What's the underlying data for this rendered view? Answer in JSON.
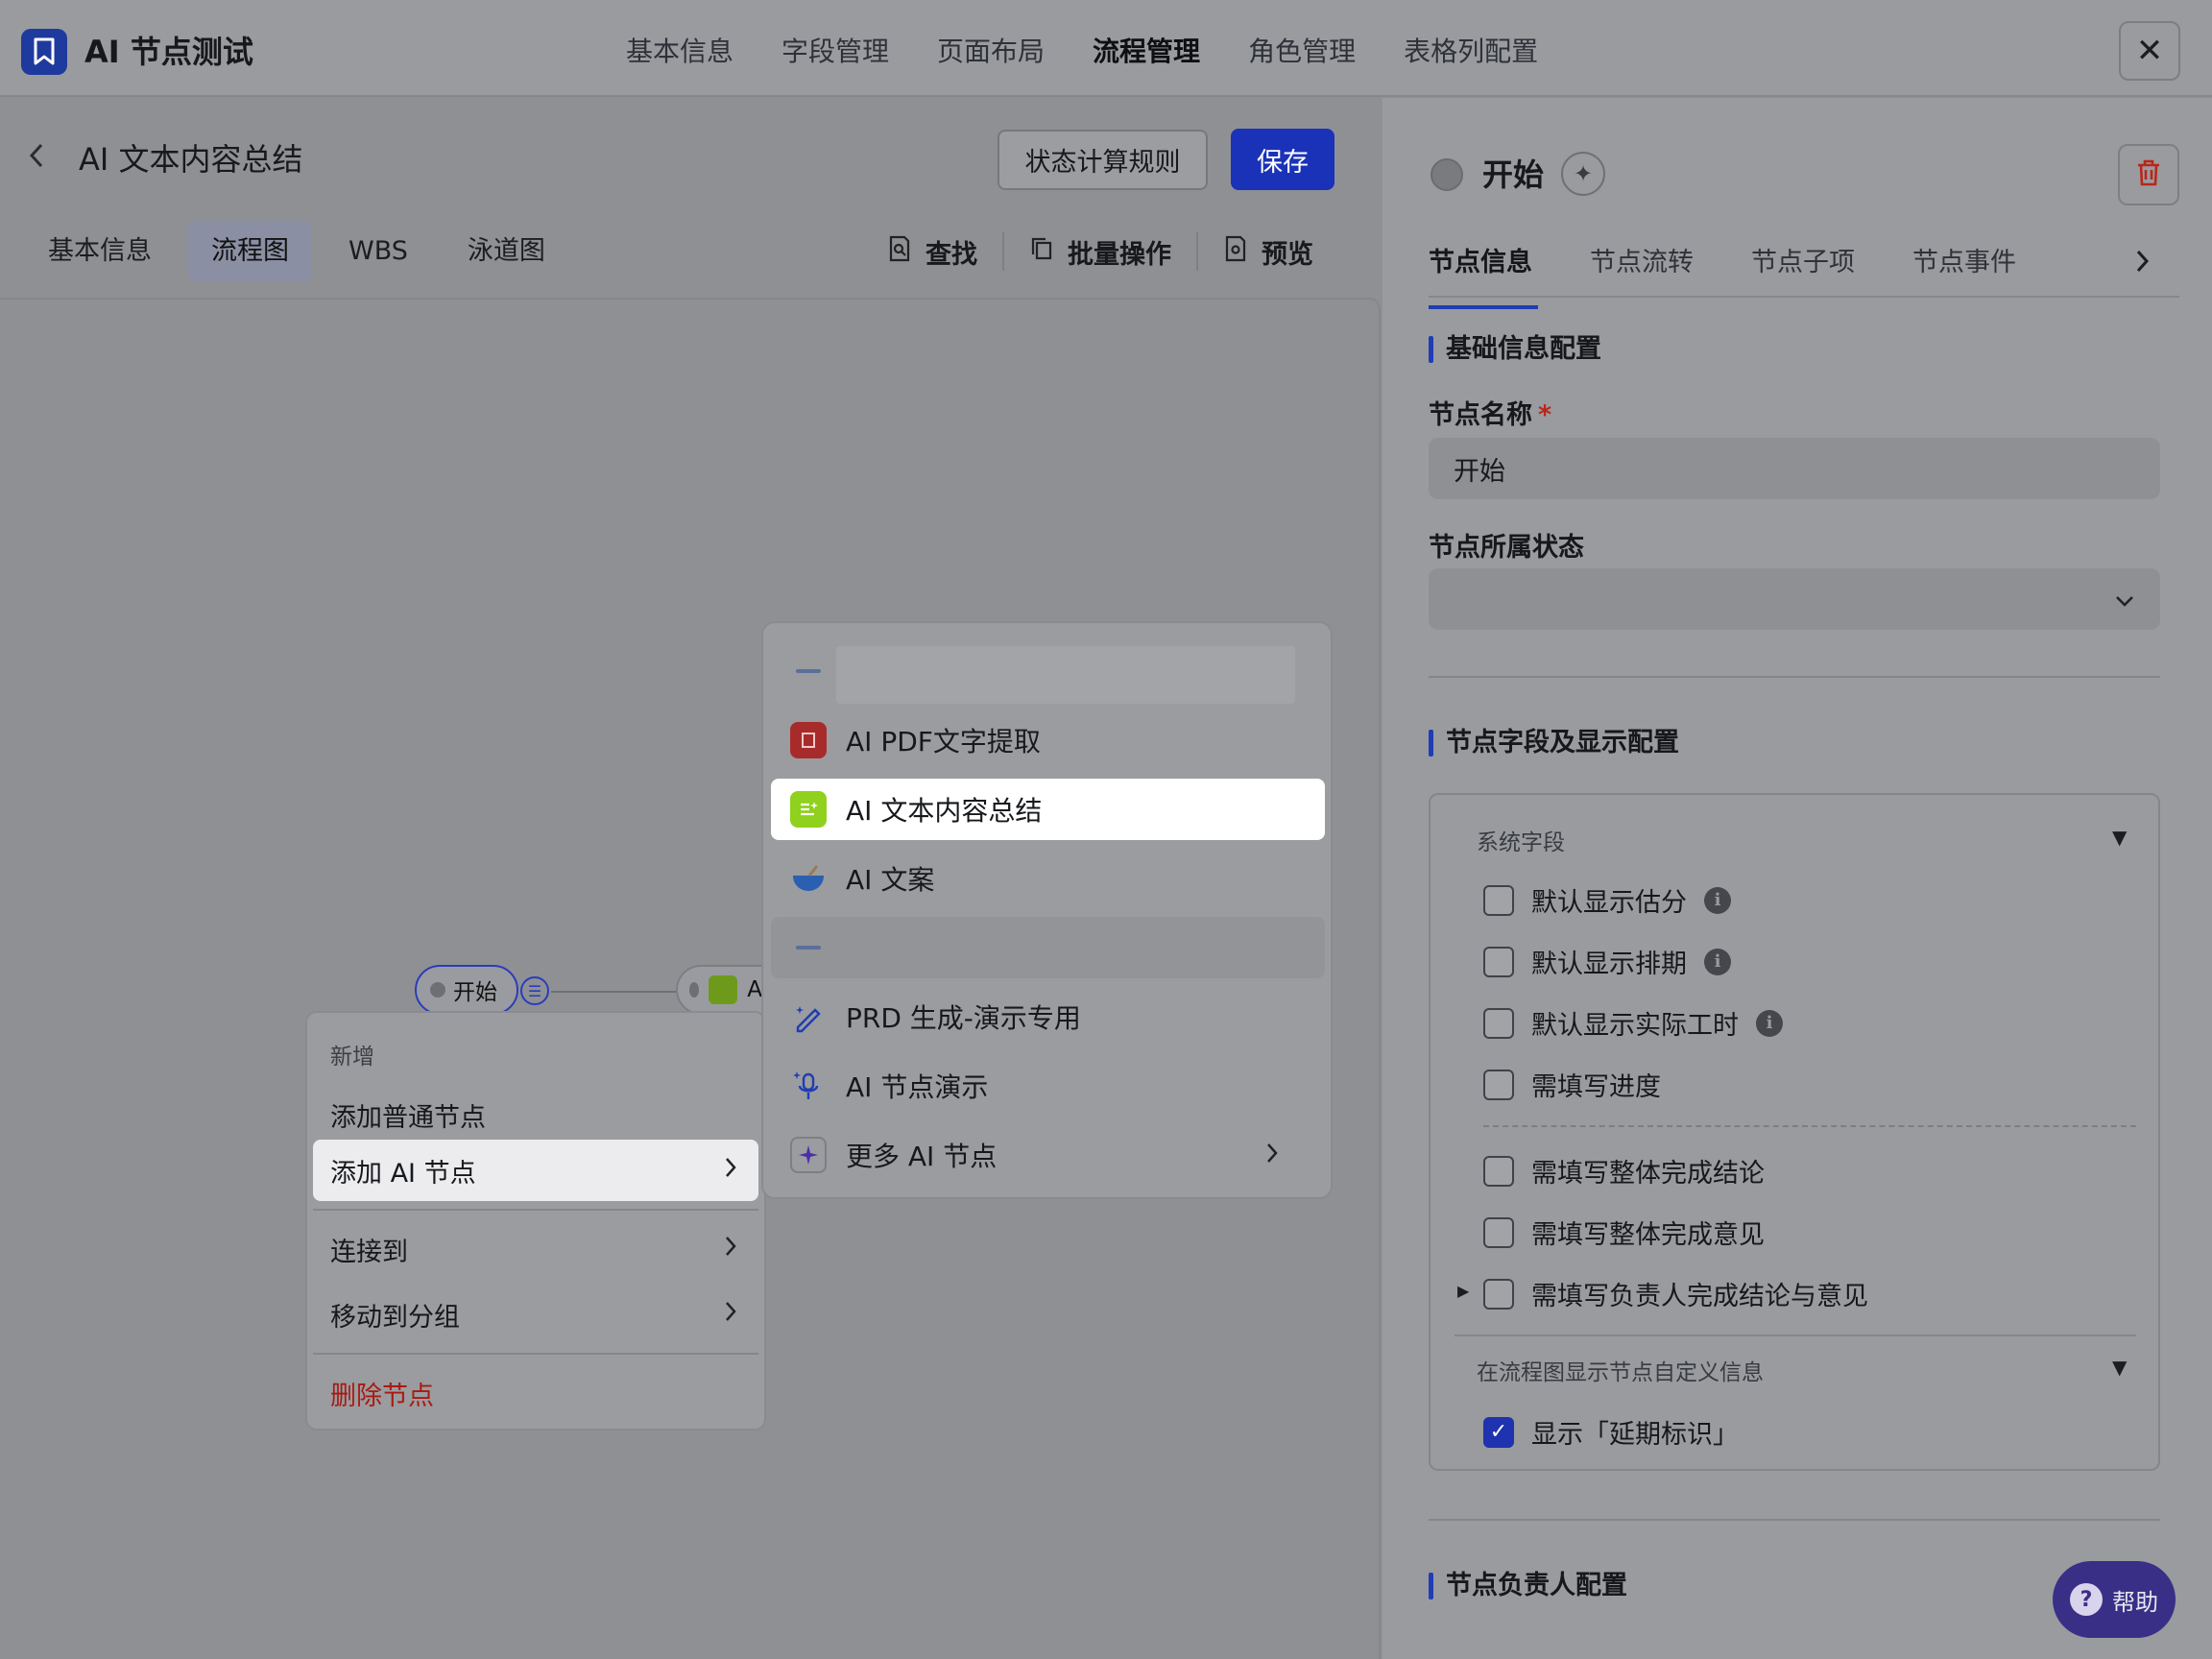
{
  "app": {
    "title": "AI 节点测试",
    "close_label": "✕"
  },
  "top_nav": [
    {
      "label": "基本信息",
      "active": false
    },
    {
      "label": "字段管理",
      "active": false
    },
    {
      "label": "页面布局",
      "active": false
    },
    {
      "label": "流程管理",
      "active": true
    },
    {
      "label": "角色管理",
      "active": false
    },
    {
      "label": "表格列配置",
      "active": false
    }
  ],
  "header": {
    "title": "AI 文本内容总结",
    "rule_button": "状态计算规则",
    "save_button": "保存"
  },
  "sub_tabs": [
    {
      "label": "基本信息",
      "active": false
    },
    {
      "label": "流程图",
      "active": true
    },
    {
      "label": "WBS",
      "active": false
    },
    {
      "label": "泳道图",
      "active": false
    }
  ],
  "tools": {
    "find": "查找",
    "batch": "批量操作",
    "preview": "预览"
  },
  "flow": {
    "start_node": "开始",
    "ai_node_partial": "A"
  },
  "context_menu": {
    "section": "新增",
    "add_normal": "添加普通节点",
    "add_ai": "添加 AI 节点",
    "connect": "连接到",
    "move_group": "移动到分组",
    "delete": "删除节点"
  },
  "ai_submenu": {
    "items": [
      {
        "label": "AI PDF文字提取",
        "icon": "pdf-icon"
      },
      {
        "label": "AI 文本内容总结",
        "icon": "summary-icon",
        "highlighted": true
      },
      {
        "label": "AI 文案",
        "icon": "bowl-icon"
      },
      {
        "label": "PRD 生成-演示专用",
        "icon": "magic-pen-icon"
      },
      {
        "label": "AI 节点演示",
        "icon": "mic-sparkle-icon"
      },
      {
        "label": "更多 AI 节点",
        "icon": "sparkle-icon"
      }
    ]
  },
  "panel": {
    "node_title": "开始",
    "tabs": [
      {
        "label": "节点信息",
        "active": true
      },
      {
        "label": "节点流转",
        "active": false
      },
      {
        "label": "节点子项",
        "active": false
      },
      {
        "label": "节点事件",
        "active": false
      }
    ],
    "section_basic": "基础信息配置",
    "name_label": "节点名称",
    "required_mark": "*",
    "name_value": "开始",
    "status_label": "节点所属状态",
    "status_value": "",
    "section_fields": "节点字段及显示配置",
    "system_fields_title": "系统字段",
    "checkboxes": [
      {
        "label": "默认显示估分",
        "checked": false,
        "info": true
      },
      {
        "label": "默认显示排期",
        "checked": false,
        "info": true
      },
      {
        "label": "默认显示实际工时",
        "checked": false,
        "info": true
      },
      {
        "label": "需填写进度",
        "checked": false,
        "info": false
      },
      {
        "label": "需填写整体完成结论",
        "checked": false,
        "info": false
      },
      {
        "label": "需填写整体完成意见",
        "checked": false,
        "info": false
      },
      {
        "label": "需填写负责人完成结论与意见",
        "checked": false,
        "info": false
      }
    ],
    "custom_info_title": "在流程图显示节点自定义信息",
    "delay_mark_label": "显示「延期标识」",
    "delay_mark_checked": true,
    "section_owner": "节点负责人配置"
  },
  "help_button": "帮助",
  "colors": {
    "brand": "#1a32b8",
    "danger": "#a81a12",
    "accent": "#1f3db5"
  }
}
